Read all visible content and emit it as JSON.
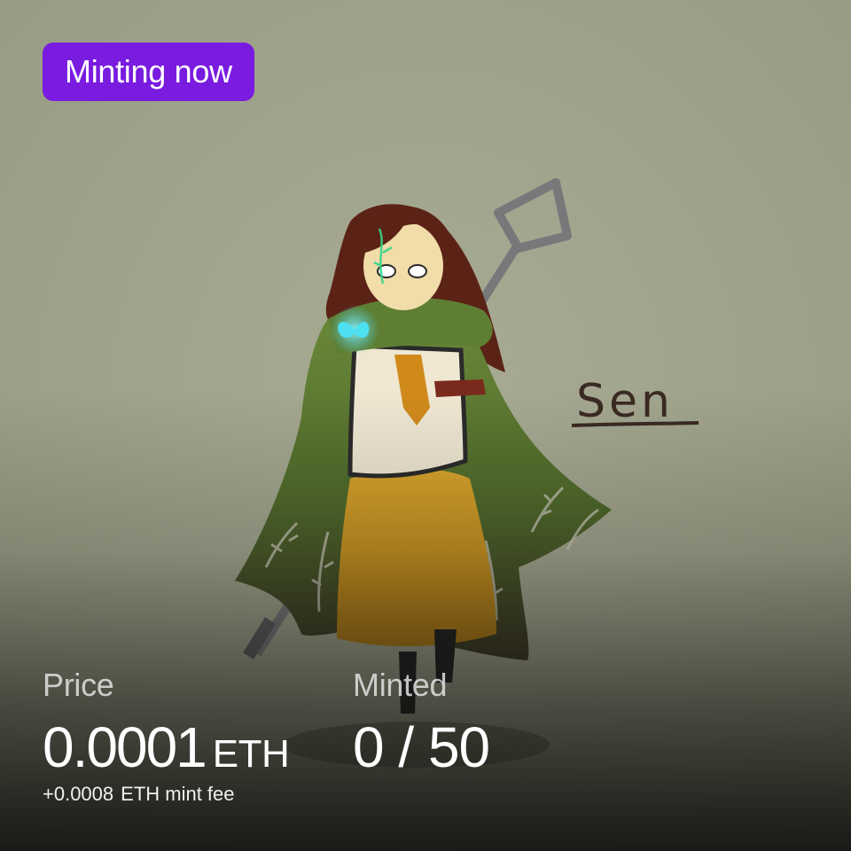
{
  "badge": {
    "label": "Minting now",
    "color": "#7a1be0"
  },
  "artwork": {
    "signature_text": "Sen",
    "subject": "hooded girl in green cloak holding staff with glowing blue butterfly"
  },
  "price": {
    "label": "Price",
    "value": "0.0001",
    "unit": "ETH",
    "fee_amount": "+0.0008",
    "fee_text": "ETH mint fee"
  },
  "minted": {
    "label": "Minted",
    "value": "0 / 50"
  }
}
